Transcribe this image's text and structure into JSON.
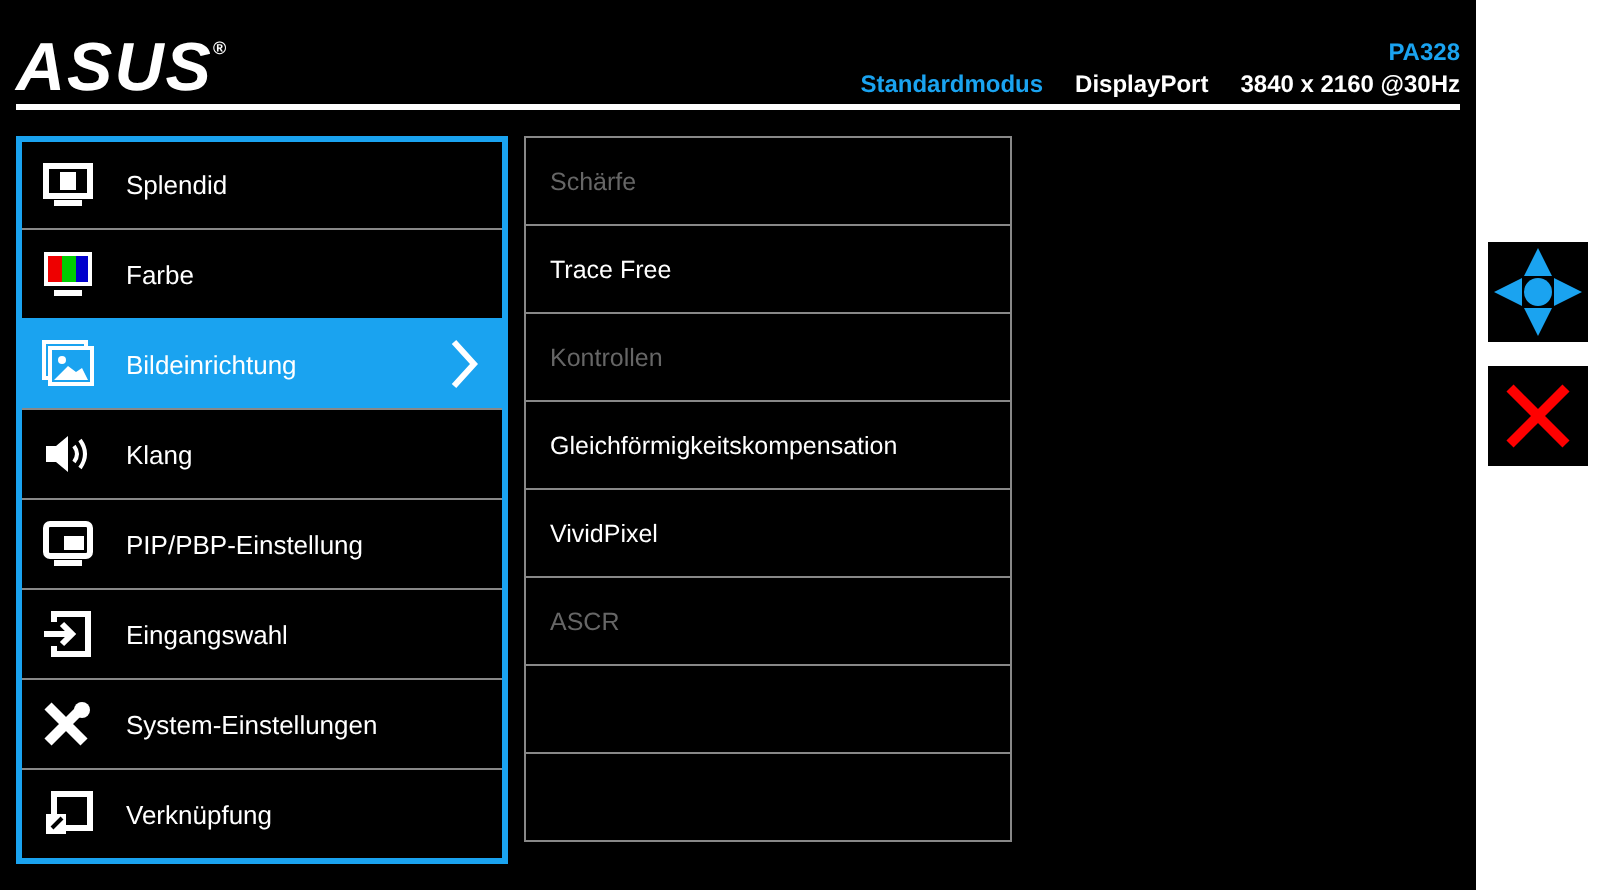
{
  "header": {
    "logo": "ASUS",
    "logo_mark": "®",
    "model": "PA328",
    "mode": "Standardmodus",
    "input": "DisplayPort",
    "resolution": "3840 x 2160 @30Hz"
  },
  "menu": [
    {
      "label": "Splendid",
      "kind": "splendid",
      "selected": false
    },
    {
      "label": "Farbe",
      "kind": "color",
      "selected": false
    },
    {
      "label": "Bildeinrichtung",
      "kind": "image",
      "selected": true
    },
    {
      "label": "Klang",
      "kind": "sound",
      "selected": false
    },
    {
      "label": "PIP/PBP-Einstellung",
      "kind": "pip",
      "selected": false
    },
    {
      "label": "Eingangswahl",
      "kind": "input",
      "selected": false
    },
    {
      "label": "System-Einstellungen",
      "kind": "tools",
      "selected": false
    },
    {
      "label": "Verknüpfung",
      "kind": "shortcut",
      "selected": false
    }
  ],
  "submenu": [
    {
      "label": "Schärfe",
      "disabled": true
    },
    {
      "label": "Trace Free",
      "disabled": false
    },
    {
      "label": "Kontrollen",
      "disabled": true
    },
    {
      "label": "Gleichförmigkeitskompensation",
      "disabled": false
    },
    {
      "label": "VividPixel",
      "disabled": false
    },
    {
      "label": "ASCR",
      "disabled": true
    }
  ]
}
